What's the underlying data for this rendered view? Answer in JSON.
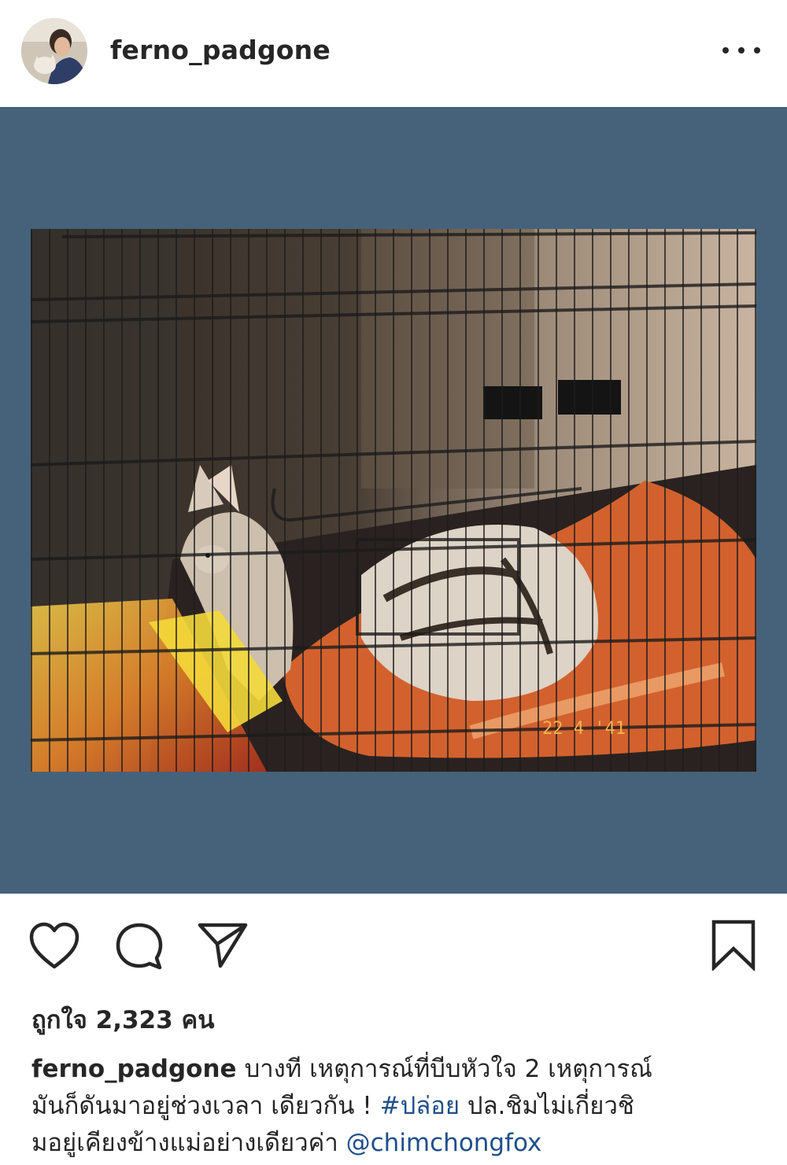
{
  "post": {
    "username": "ferno_padgone",
    "avatar_icon": "profile-avatar",
    "more_icon": "more-options-icon",
    "media_background": "#45627a",
    "photo_stamp": "22 4 '41",
    "photo_description": null
  },
  "actions": {
    "like_icon": "heart-icon",
    "comment_icon": "comment-icon",
    "share_icon": "send-icon",
    "save_icon": "bookmark-icon"
  },
  "likes": {
    "text": "ถูกใจ 2,323 คน"
  },
  "caption": {
    "username": "ferno_padgone",
    "line1": "บางที เหตุการณ์ที่บีบหัวใจ 2 เหตุการณ์",
    "line2_text": "มันก็ดันมาอยู่ช่วงเวลา เดียวกัน ! ",
    "line2_tag": "#ปล่อย",
    "line2_after": " ปล.ชิมไม่เกี่ยวชิ",
    "line3_text": "มอยู่เคียงข้างแม่อย่างเดียวค่า ",
    "line3_mention": "@chimchongfox"
  }
}
